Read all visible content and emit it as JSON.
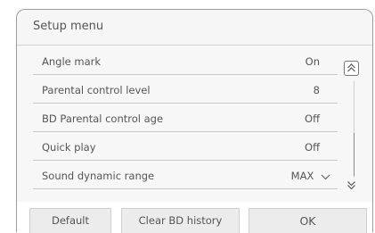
{
  "title": "Setup menu",
  "rows": [
    {
      "label": "Angle mark",
      "value": "On"
    },
    {
      "label": "Parental control level",
      "value": "8"
    },
    {
      "label": "BD Parental control age",
      "value": "Off"
    },
    {
      "label": "Quick play",
      "value": "Off"
    },
    {
      "label": "Sound dynamic range",
      "value": "MAX",
      "icon": "chevron-down-icon"
    }
  ],
  "scroll": {
    "up_icon": "double-chevron-up-icon",
    "down_icon": "double-chevron-down-icon"
  },
  "buttons": {
    "default_label": "Default",
    "clear_label": "Clear BD history",
    "ok_label": "OK"
  },
  "colors": {
    "text": "#555555",
    "list_background": "#f7f7f7",
    "button_background": "#ececec",
    "divider": "#c9c9c9"
  }
}
